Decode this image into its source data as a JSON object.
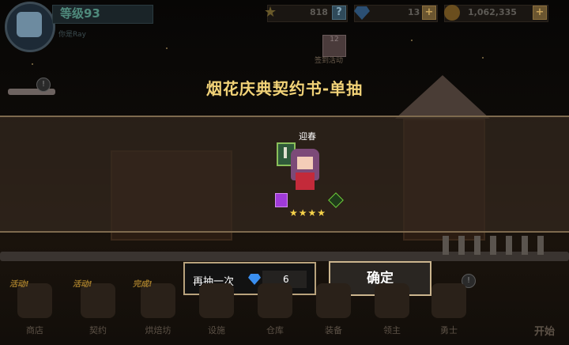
{
  "hud": {
    "level": "等级93",
    "subtitle": "你是Ray",
    "stars_count": "818",
    "gems_count": "13",
    "gold_count": "1,062,335",
    "event_day": "12",
    "event_label": "签到活动"
  },
  "dialog": {
    "title": "烟花庆典契约书-单抽",
    "character_name": "迎春",
    "stars": "★★★★",
    "draw_again_label": "再抽一次",
    "draw_again_cost": "6",
    "confirm_label": "确定"
  },
  "nav": {
    "items": [
      {
        "label": "商店",
        "tag": "活动!"
      },
      {
        "label": "契约",
        "tag": "活动!"
      },
      {
        "label": "烘焙坊",
        "tag": "完成!"
      },
      {
        "label": "设施",
        "tag": ""
      },
      {
        "label": "仓库",
        "tag": ""
      },
      {
        "label": "装备",
        "tag": ""
      },
      {
        "label": "领主",
        "tag": ""
      },
      {
        "label": "勇士",
        "tag": ""
      }
    ],
    "start_label": "开始"
  },
  "colors": {
    "title": "#f2d378",
    "band": "#34281e",
    "star": "#f6d24a",
    "button_border": "#cbb58e"
  }
}
